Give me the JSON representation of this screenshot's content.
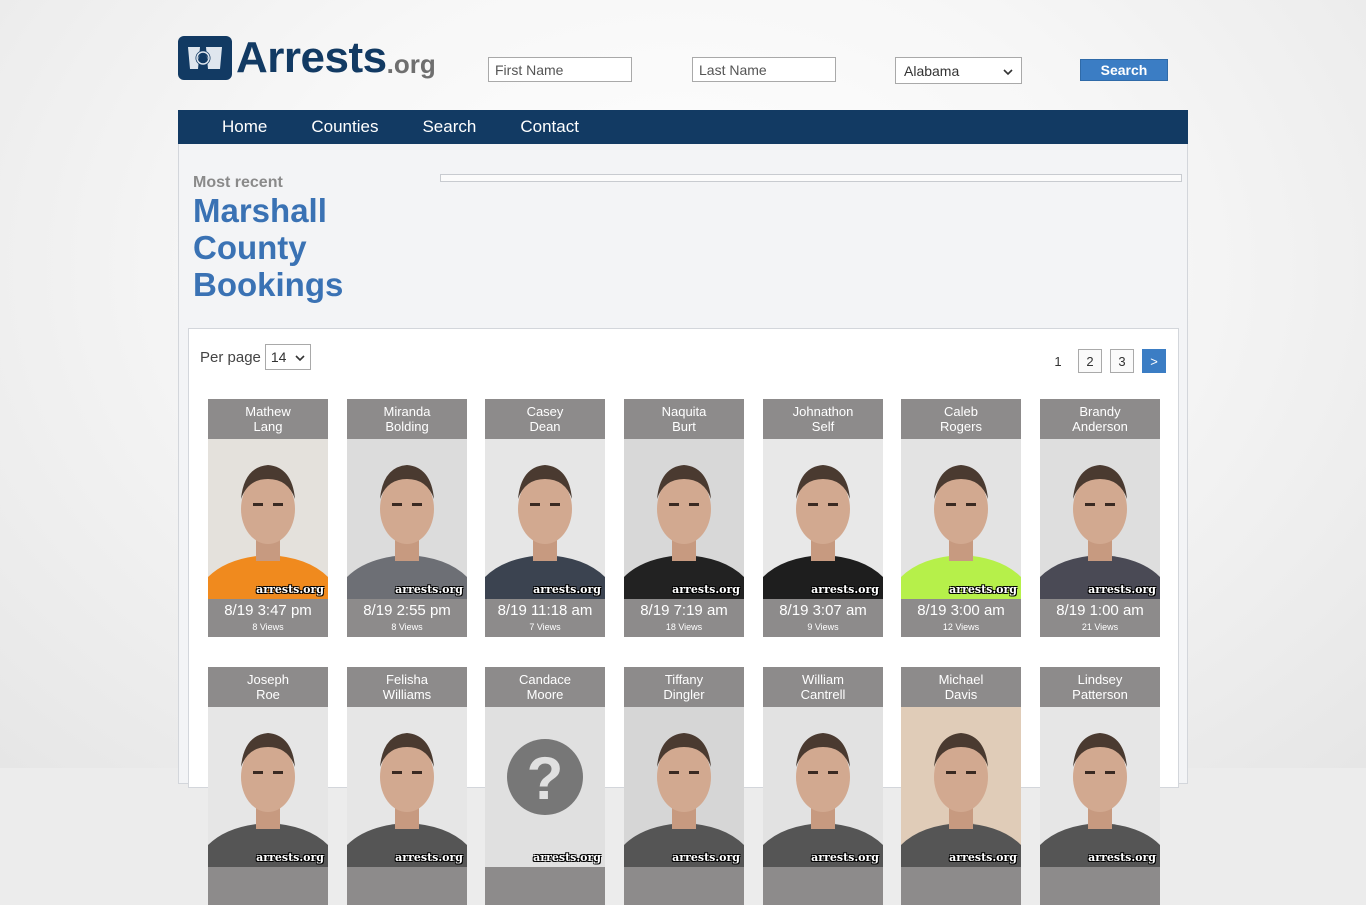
{
  "site": {
    "logo_main": "Arrests",
    "logo_suffix": ".org"
  },
  "search": {
    "first_placeholder": "First Name",
    "last_placeholder": "Last Name",
    "state_value": "Alabama",
    "button_label": "Search"
  },
  "nav": [
    "Home",
    "Counties",
    "Search",
    "Contact"
  ],
  "heading": {
    "kicker": "Most recent",
    "line1": "Marshall",
    "line2": "County",
    "line3": "Bookings"
  },
  "listing": {
    "per_page_label": "Per page",
    "per_page_value": "14",
    "pages": [
      "1",
      "2",
      "3",
      ">"
    ]
  },
  "people": [
    {
      "first": "Mathew",
      "last": "Lang",
      "time": "8/19 3:47 pm",
      "views": "8 Views",
      "shirt": "#f08a1e",
      "bg": "#e4e1dc"
    },
    {
      "first": "Miranda",
      "last": "Bolding",
      "time": "8/19 2:55 pm",
      "views": "8 Views",
      "shirt": "#6d6f75",
      "bg": "#dcdcdc"
    },
    {
      "first": "Casey",
      "last": "Dean",
      "time": "8/19 11:18 am",
      "views": "7 Views",
      "shirt": "#3b4350",
      "bg": "#e6e6e6"
    },
    {
      "first": "Naquita",
      "last": "Burt",
      "time": "8/19 7:19 am",
      "views": "18 Views",
      "shirt": "#222222",
      "bg": "#d8d8d8"
    },
    {
      "first": "Johnathon",
      "last": "Self",
      "time": "8/19 3:07 am",
      "views": "9 Views",
      "shirt": "#1e1e1e",
      "bg": "#e8e8e8"
    },
    {
      "first": "Caleb",
      "last": "Rogers",
      "time": "8/19 3:00 am",
      "views": "12 Views",
      "shirt": "#b6f04a",
      "bg": "#e3e3e3"
    },
    {
      "first": "Brandy",
      "last": "Anderson",
      "time": "8/19 1:00 am",
      "views": "21 Views",
      "shirt": "#4a4a55",
      "bg": "#dedede"
    },
    {
      "first": "Joseph",
      "last": "Roe",
      "time": "",
      "views": "",
      "shirt": "#555",
      "bg": "#e6e6e6"
    },
    {
      "first": "Felisha",
      "last": "Williams",
      "time": "",
      "views": "",
      "shirt": "#555",
      "bg": "#e6e6e6"
    },
    {
      "first": "Candace",
      "last": "Moore",
      "time": "",
      "views": "",
      "shirt": "#555",
      "bg": "#e0e0e0"
    },
    {
      "first": "Tiffany",
      "last": "Dingler",
      "time": "",
      "views": "",
      "shirt": "#555",
      "bg": "#d6d6d6"
    },
    {
      "first": "William",
      "last": "Cantrell",
      "time": "",
      "views": "",
      "shirt": "#555",
      "bg": "#e2e2e2"
    },
    {
      "first": "Michael",
      "last": "Davis",
      "time": "",
      "views": "",
      "shirt": "#555",
      "bg": "#e0ccb8"
    },
    {
      "first": "Lindsey",
      "last": "Patterson",
      "time": "",
      "views": "",
      "shirt": "#555",
      "bg": "#e6e6e6"
    }
  ],
  "watermark": "arrests.org",
  "colors": {
    "navy": "#123a63",
    "accent": "#3b7dc4",
    "card_gray": "#8d8b8b"
  }
}
